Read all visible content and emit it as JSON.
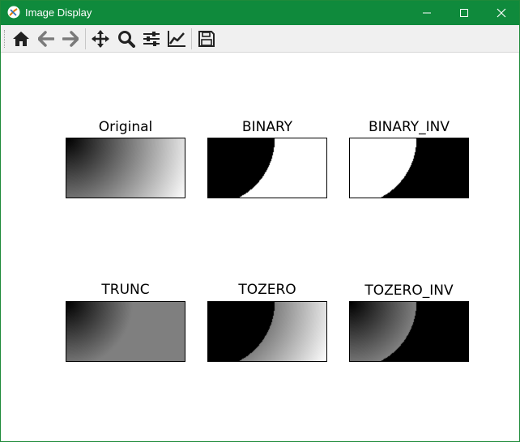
{
  "window": {
    "title": "Image Display"
  },
  "toolbar": {
    "buttons": [
      {
        "name": "home-icon"
      },
      {
        "name": "back-icon"
      },
      {
        "name": "forward-icon"
      },
      {
        "name": "pan-icon"
      },
      {
        "name": "zoom-icon"
      },
      {
        "name": "configure-subplots-icon"
      },
      {
        "name": "edit-axis-icon"
      },
      {
        "name": "save-icon"
      }
    ]
  },
  "subplots": [
    {
      "title": "Original",
      "mode": "original"
    },
    {
      "title": "BINARY",
      "mode": "binary"
    },
    {
      "title": "BINARY_INV",
      "mode": "binary_inv"
    },
    {
      "title": "TRUNC",
      "mode": "trunc"
    },
    {
      "title": "TOZERO",
      "mode": "tozero"
    },
    {
      "title": "TOZERO_INV",
      "mode": "tozero_inv"
    }
  ],
  "colors": {
    "titlebar": "#0f8a3c",
    "toolbar": "#f0f0f0",
    "threshold": 127
  }
}
